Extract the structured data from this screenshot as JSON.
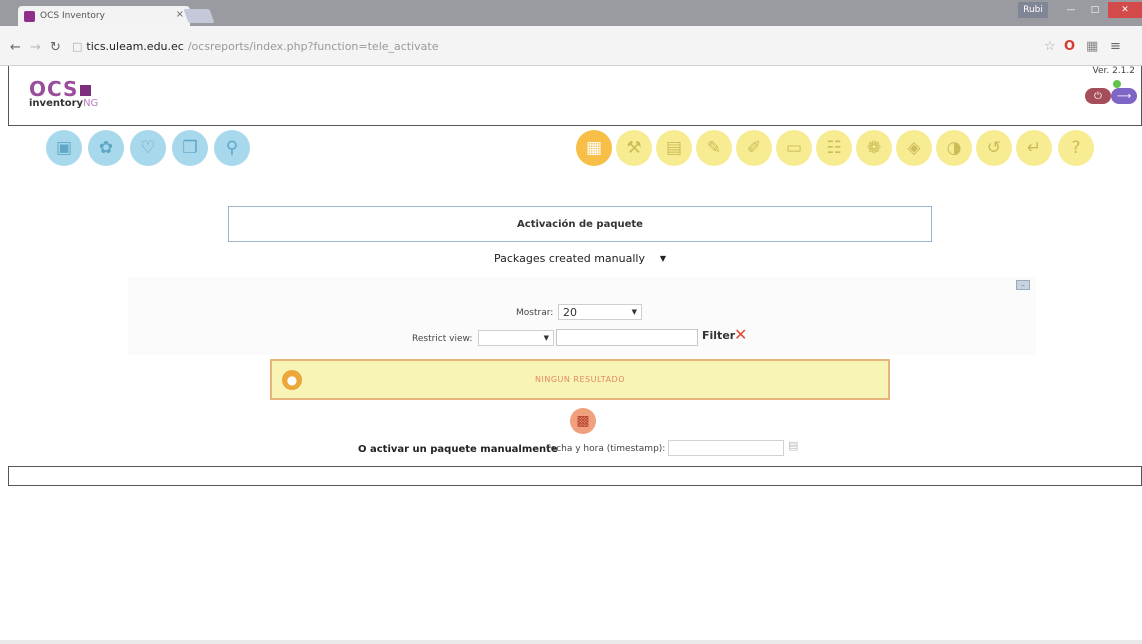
{
  "browser": {
    "tab_title": "OCS Inventory",
    "tab_close": "×",
    "window_user": "Rubi",
    "url_host": "tics.uleam.edu.ec",
    "url_path": "/ocsreports/index.php?function=tele_activate"
  },
  "header": {
    "logo_text": "OCS",
    "logo_sub": "inventory",
    "logo_ng": "NG",
    "version": "Ver. 2.1.2"
  },
  "icons": {
    "left": [
      "computers-icon",
      "network-icon",
      "software-icon",
      "groups-icon",
      "search-icon"
    ],
    "right": [
      "deployment-icon",
      "administration-icon",
      "calendar-icon",
      "notes-icon",
      "edit-icon",
      "folder-icon",
      "devices-icon",
      "plugins-icon",
      "puzzle-icon",
      "config-icon",
      "refresh-icon",
      "return-icon",
      "help-icon"
    ],
    "active_index": 0
  },
  "main": {
    "section_title": "Activación de paquete",
    "package_select": "Packages created manually",
    "mostrar_label": "Mostrar:",
    "mostrar_value": "20",
    "restrict_label": "Restrict view:",
    "restrict_value": "",
    "filter_label": "Filter",
    "result_text": "NINGUN RESULTADO",
    "manual_label": "O activar un paquete manualmente",
    "timestamp_label": "Fecha y hora (timestamp):",
    "timestamp_value": ""
  },
  "colors": {
    "accent_purple": "#8f2f8a",
    "icon_blue": "#a8d8ec",
    "icon_yellow": "#f7ec92",
    "warning_bg": "#f8f4b6",
    "warning_border": "#e6b57c"
  }
}
